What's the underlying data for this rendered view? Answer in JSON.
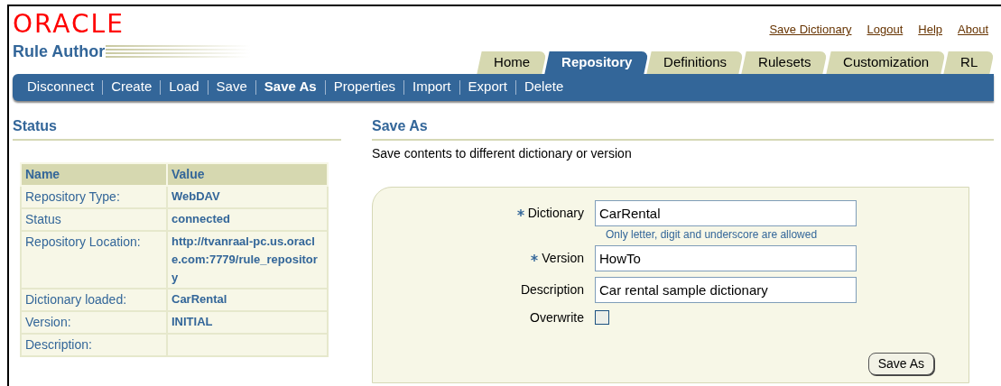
{
  "header": {
    "logo": "ORACLE",
    "app_title": "Rule Author",
    "global_links": [
      "Save Dictionary",
      "Logout",
      "Help",
      "About"
    ]
  },
  "tabs": [
    {
      "label": "Home",
      "selected": false
    },
    {
      "label": "Repository",
      "selected": true
    },
    {
      "label": "Definitions",
      "selected": false
    },
    {
      "label": "Rulesets",
      "selected": false
    },
    {
      "label": "Customization",
      "selected": false
    },
    {
      "label": "RL",
      "selected": false
    }
  ],
  "subnav": [
    {
      "label": "Disconnect",
      "selected": false
    },
    {
      "label": "Create",
      "selected": false
    },
    {
      "label": "Load",
      "selected": false
    },
    {
      "label": "Save",
      "selected": false
    },
    {
      "label": "Save As",
      "selected": true
    },
    {
      "label": "Properties",
      "selected": false
    },
    {
      "label": "Import",
      "selected": false
    },
    {
      "label": "Export",
      "selected": false
    },
    {
      "label": "Delete",
      "selected": false
    }
  ],
  "status": {
    "heading": "Status",
    "columns": [
      "Name",
      "Value"
    ],
    "rows": [
      {
        "name": "Repository Type:",
        "value": "WebDAV"
      },
      {
        "name": "Status",
        "value": "connected"
      },
      {
        "name": "Repository Location:",
        "value": "http://tvanraal-pc.us.oracle.com:7779/rule_repository"
      },
      {
        "name": "Dictionary loaded:",
        "value": "CarRental"
      },
      {
        "name": "Version:",
        "value": "INITIAL"
      },
      {
        "name": "Description:"
      }
    ]
  },
  "save_as": {
    "heading": "Save As",
    "description": "Save contents to different dictionary or version",
    "fields": [
      {
        "kind": "text",
        "label": "Dictionary",
        "required": true,
        "value": "CarRental",
        "hint": "Only letter, digit and underscore are allowed"
      },
      {
        "kind": "text",
        "label": "Version",
        "required": true,
        "value": "HowTo"
      },
      {
        "kind": "text",
        "label": "Description",
        "required": false,
        "value": "Car rental sample dictionary"
      },
      {
        "kind": "checkbox",
        "label": "Overwrite",
        "required": false,
        "checked": false
      }
    ],
    "button": "Save As"
  }
}
